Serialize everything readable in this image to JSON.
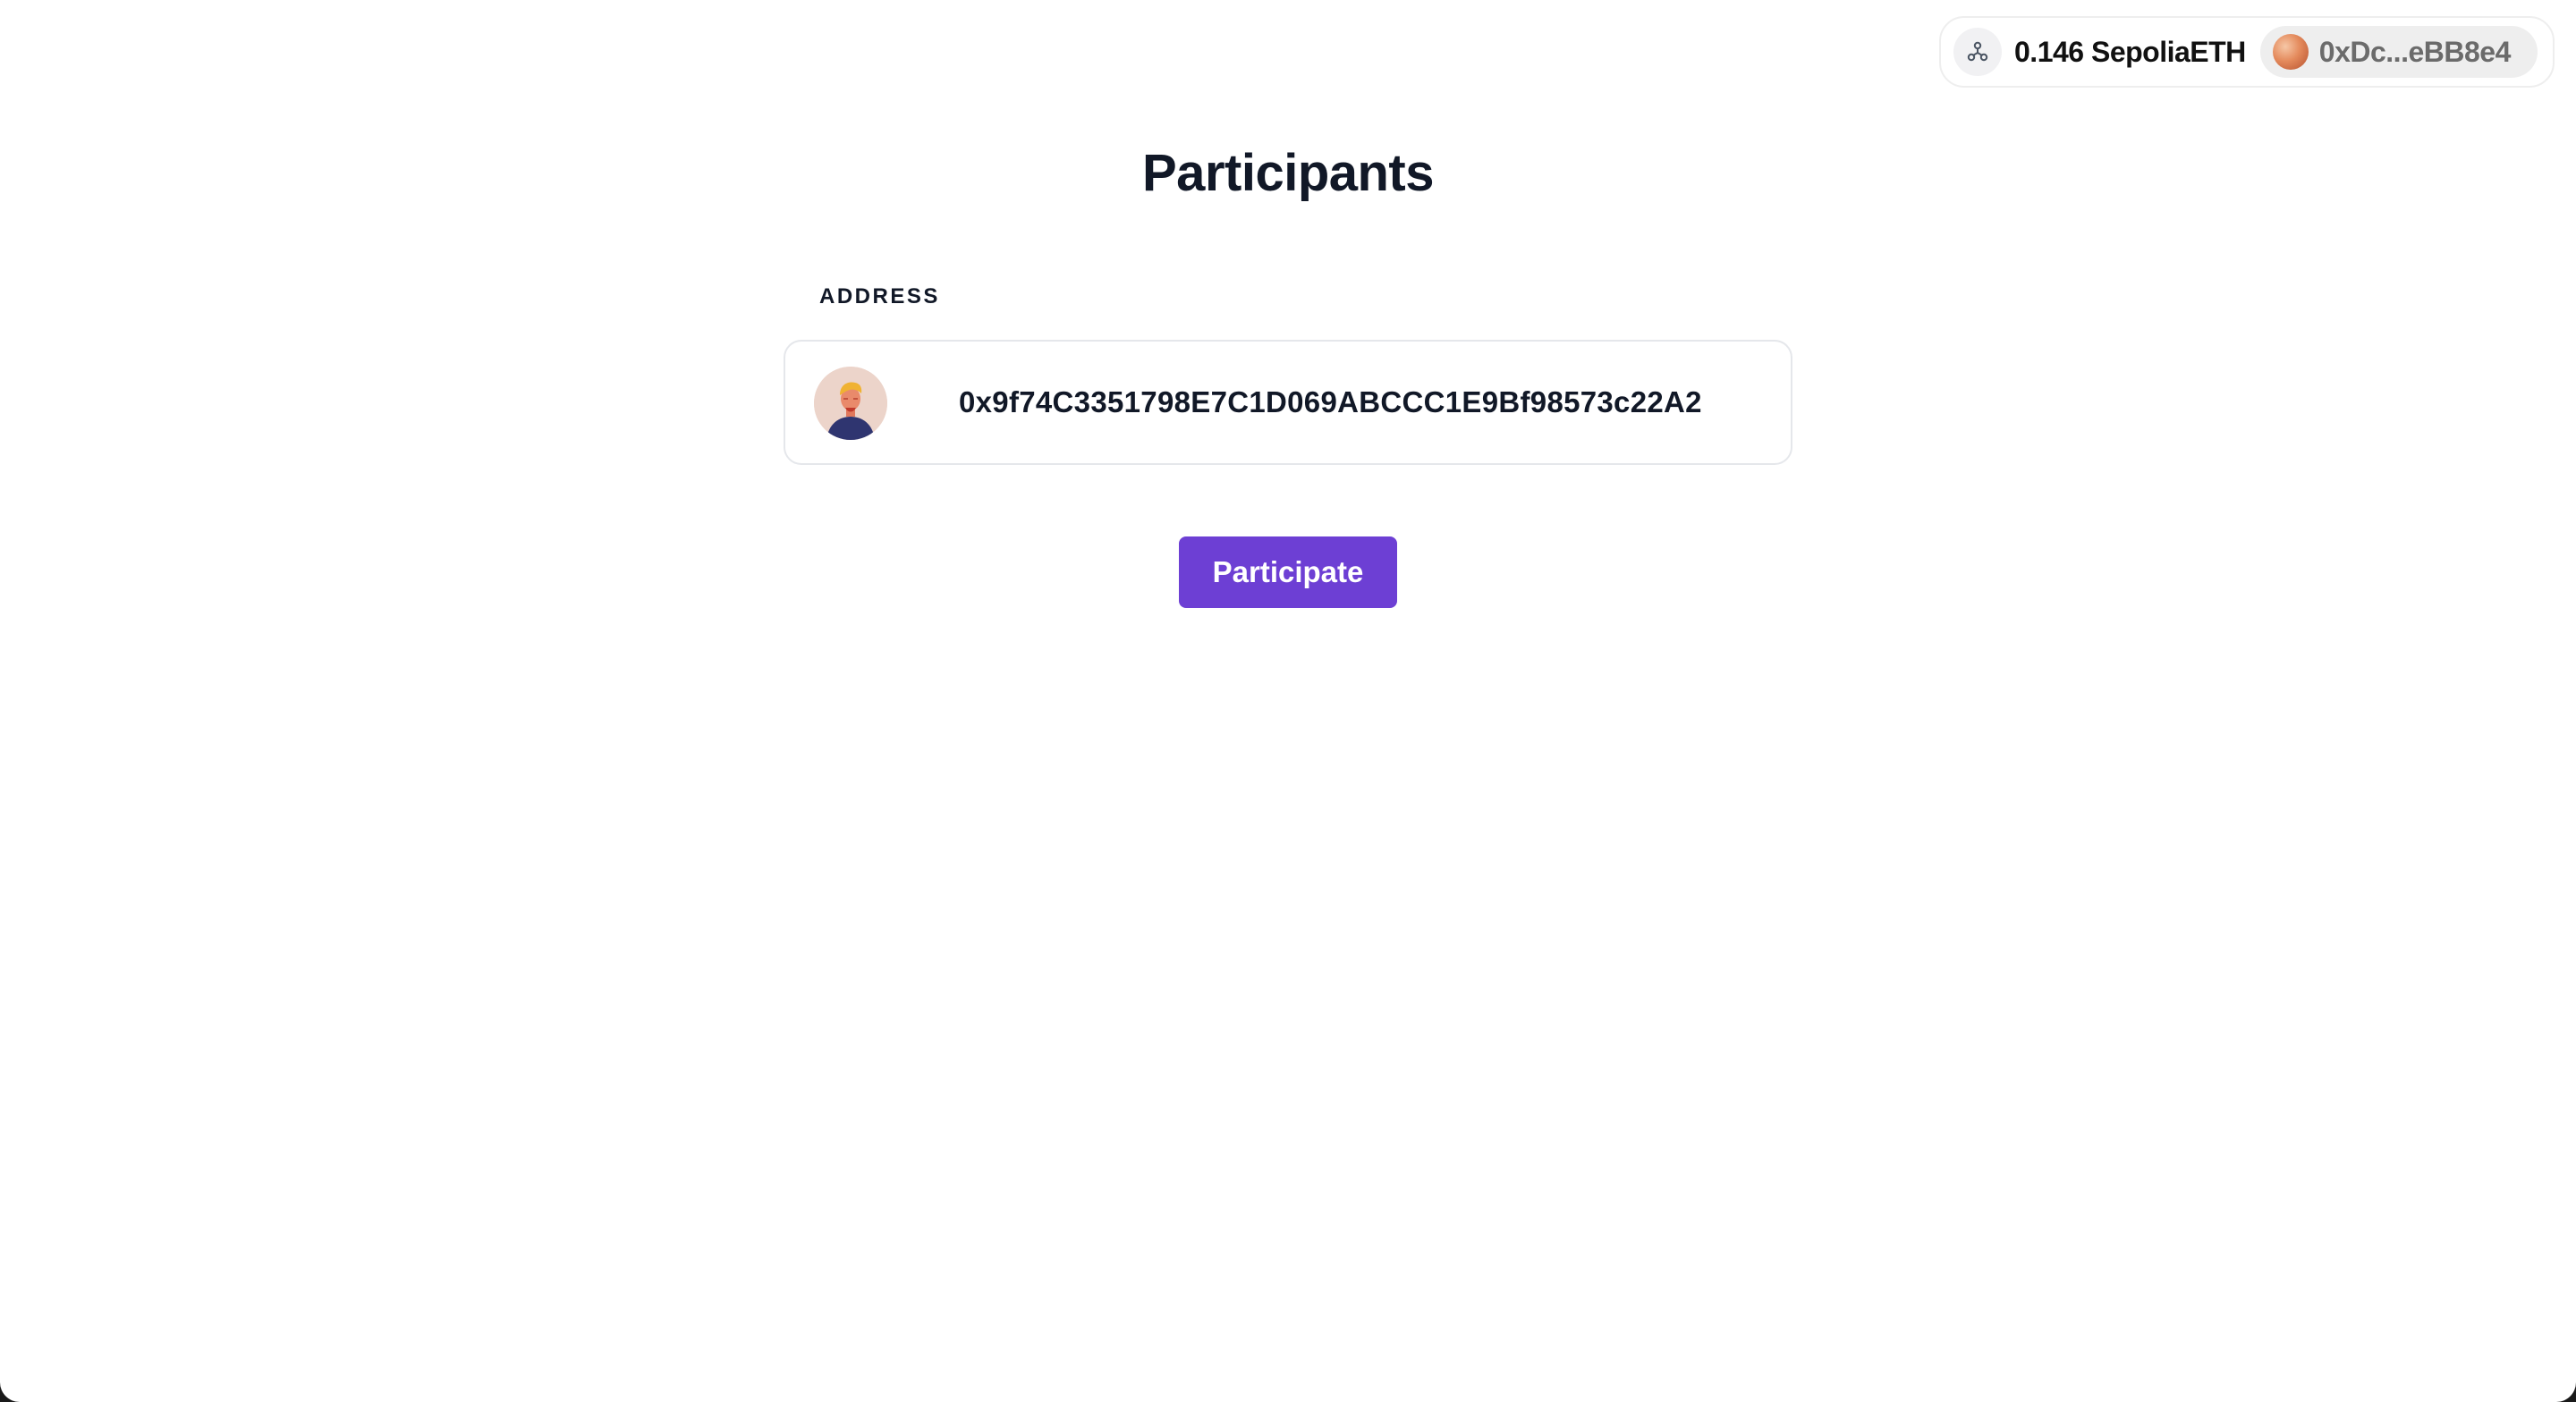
{
  "wallet": {
    "balance": "0.146 SepoliaETH",
    "account_short": "0xDc...eBB8e4",
    "network_icon": "network-nodes-icon"
  },
  "page": {
    "title": "Participants"
  },
  "table": {
    "column_header": "ADDRESS",
    "rows": [
      {
        "address": "0x9f74C3351798E7C1D069ABCCC1E9Bf98573c22A2"
      }
    ]
  },
  "actions": {
    "participate_label": "Participate"
  },
  "colors": {
    "primary_button": "#6d3fd4",
    "title_text": "#111827",
    "row_border": "#e5e7eb"
  }
}
